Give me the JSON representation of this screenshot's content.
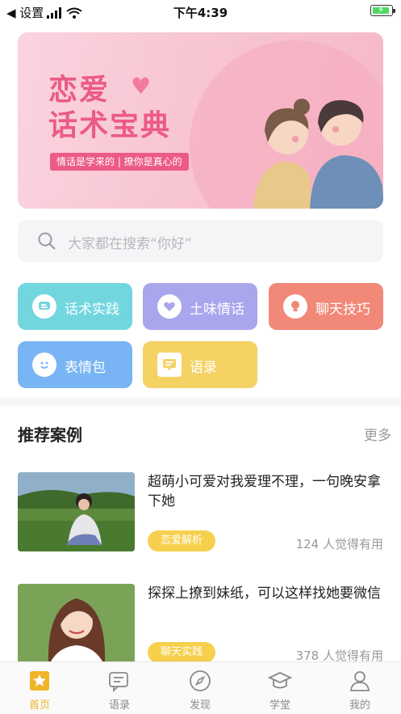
{
  "status_bar": {
    "back_label": "◀ 设置",
    "time": "下午4:39"
  },
  "banner": {
    "title_line1": "恋爱",
    "title_line2": "话术宝典",
    "tagline": "情话是学来的 | 撩你是真心的"
  },
  "search": {
    "placeholder": "大家都在搜索“你好”"
  },
  "categories": [
    {
      "label": "话术实践",
      "color": "#72d6df",
      "icon": "chat-bubble-icon"
    },
    {
      "label": "土味情话",
      "color": "#a9a6ee",
      "icon": "heart-hand-icon"
    },
    {
      "label": "聊天技巧",
      "color": "#f28878",
      "icon": "lightbulb-icon"
    },
    {
      "label": "表情包",
      "color": "#79b5f4",
      "icon": "smiley-icon"
    },
    {
      "label": "语录",
      "color": "#f4d264",
      "icon": "message-icon"
    }
  ],
  "section": {
    "title": "推荐案例",
    "more": "更多"
  },
  "cases": [
    {
      "title": "超萌小可爱对我爱理不理，一句晚安拿下她",
      "tag": "恋爱解析",
      "likes": "124 人觉得有用"
    },
    {
      "title": "探探上撩到妹纸，可以这样找她要微信",
      "tag": "聊天实践",
      "likes": "378 人觉得有用"
    }
  ],
  "tabs": [
    {
      "label": "首页",
      "active": true
    },
    {
      "label": "语录",
      "active": false
    },
    {
      "label": "发现",
      "active": false
    },
    {
      "label": "学堂",
      "active": false
    },
    {
      "label": "我的",
      "active": false
    }
  ],
  "colors": {
    "accent": "#f0b429",
    "banner_pink": "#ec5a86",
    "tag_yellow": "#f6d04d"
  }
}
